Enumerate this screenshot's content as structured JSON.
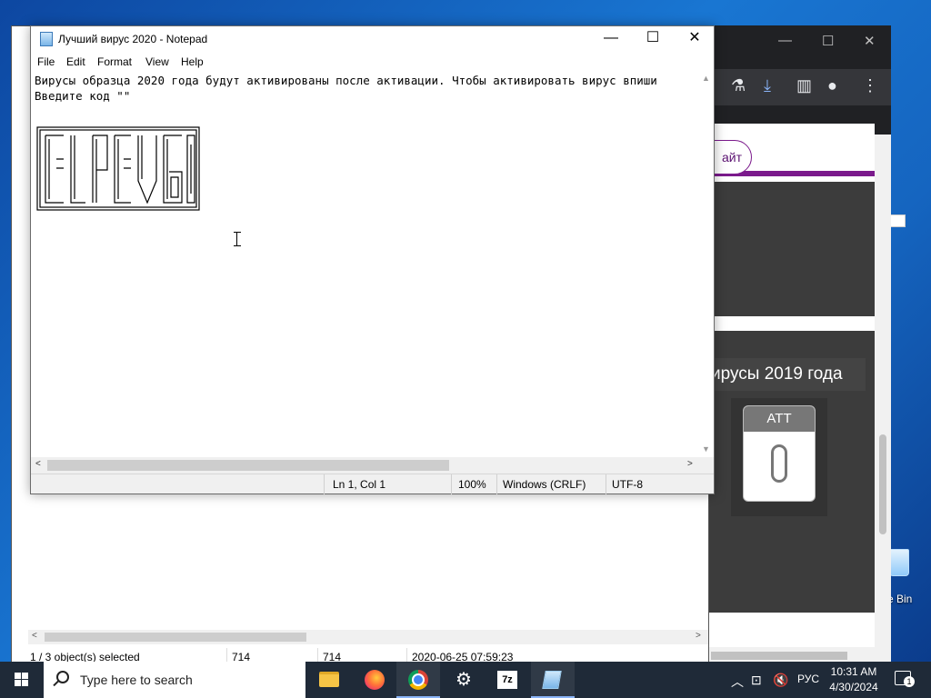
{
  "desktop": {
    "recycle_bin_label": "e Bin"
  },
  "explorer": {
    "status": {
      "selected": "1 / 3 object(s) selected",
      "size1": "714",
      "size2": "714",
      "date": "2020-06-25 07:59:23"
    }
  },
  "browser": {
    "pill_button": "айт",
    "card_title": "ирусы 2019 года",
    "att_label": "ATT"
  },
  "notepad": {
    "title": "Лучший вирус 2020 - Notepad",
    "menu": [
      "File",
      "Edit",
      "Format",
      "View",
      "Help"
    ],
    "line1": "Вирусы образца 2020 года будут активированы после активации. Чтобы активировать вирус впиши",
    "line2": "Введите код \"\"",
    "status": {
      "position": "Ln 1, Col 1",
      "zoom": "100%",
      "line_ending": "Windows (CRLF)",
      "encoding": "UTF-8"
    }
  },
  "taskbar": {
    "search_placeholder": "Type here to search",
    "language": "РУС",
    "time": "10:31 AM",
    "date": "4/30/2024",
    "notification_count": "1"
  }
}
